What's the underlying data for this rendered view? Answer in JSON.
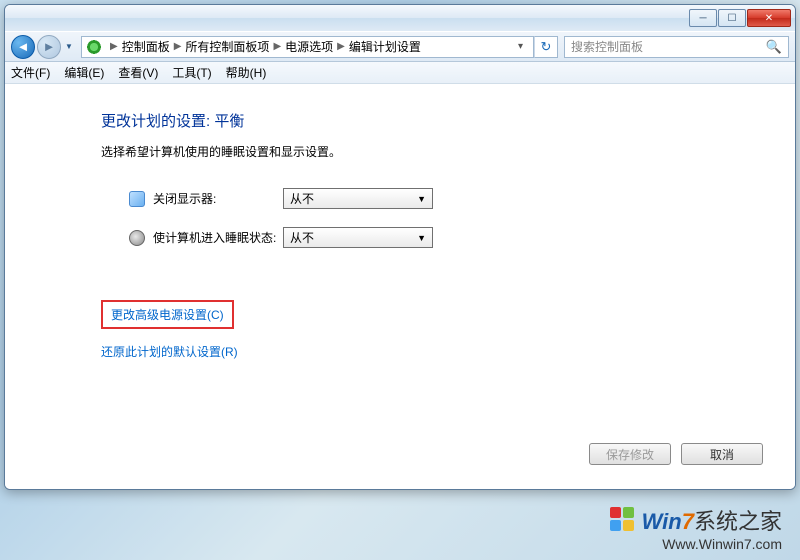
{
  "titlebar": {
    "minimize": "─",
    "maximize": "☐",
    "close": "✕"
  },
  "breadcrumb": {
    "items": [
      "控制面板",
      "所有控制面板项",
      "电源选项",
      "编辑计划设置"
    ]
  },
  "search": {
    "placeholder": "搜索控制面板"
  },
  "menubar": {
    "file": "文件(F)",
    "edit": "编辑(E)",
    "view": "查看(V)",
    "tools": "工具(T)",
    "help": "帮助(H)"
  },
  "content": {
    "heading": "更改计划的设置: 平衡",
    "subtext": "选择希望计算机使用的睡眠设置和显示设置。",
    "row1_label": "关闭显示器:",
    "row2_label": "使计算机进入睡眠状态:",
    "dropdown_value": "从不",
    "link_advanced": "更改高级电源设置(C)",
    "link_restore": "还原此计划的默认设置(R)",
    "btn_save": "保存修改",
    "btn_cancel": "取消"
  },
  "watermark": {
    "brand_win": "Win",
    "brand_7": "7",
    "brand_zh": "系统之家",
    "url": "Www.Winwin7.com"
  }
}
